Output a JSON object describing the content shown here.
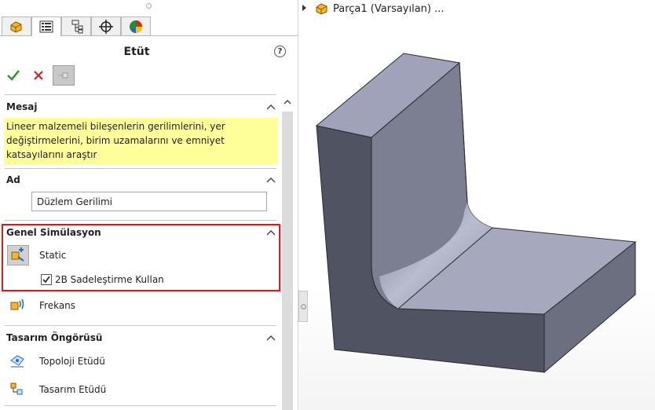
{
  "panel": {
    "title": "Etüt",
    "help_icon": "?",
    "tabs": [
      "feature-manager-icon",
      "property-manager-icon",
      "configuration-manager-icon",
      "dim-xpert-icon",
      "display-manager-icon"
    ],
    "actions": {
      "ok": "check-icon",
      "cancel": "close-icon",
      "pin": "pin-icon"
    }
  },
  "message": {
    "header": "Mesaj",
    "text": "Lineer malzemeli bileşenlerin gerilimlerini, yer değiştirmelerini, birim uzamalarını ve emniyet katsayılarını araştır"
  },
  "name_section": {
    "header": "Ad",
    "value": "Düzlem Gerilimi"
  },
  "general_sim": {
    "header": "Genel Simülasyon",
    "static_label": "Static",
    "use_2d_label": "2B Sadeleştirme Kullan",
    "use_2d_checked": true,
    "frequency_label": "Frekans"
  },
  "design_insight": {
    "header": "Tasarım Öngörüsü",
    "topology_label": "Topoloji Etüdü",
    "design_study_label": "Tasarım Etüdü"
  },
  "tree": {
    "part_label": "Parça1 (Varsayılan) ..."
  },
  "colors": {
    "highlight": "#e8141c",
    "message_bg": "#ffff99",
    "ok_green": "#2e9e2e",
    "cancel_red": "#d42020"
  }
}
